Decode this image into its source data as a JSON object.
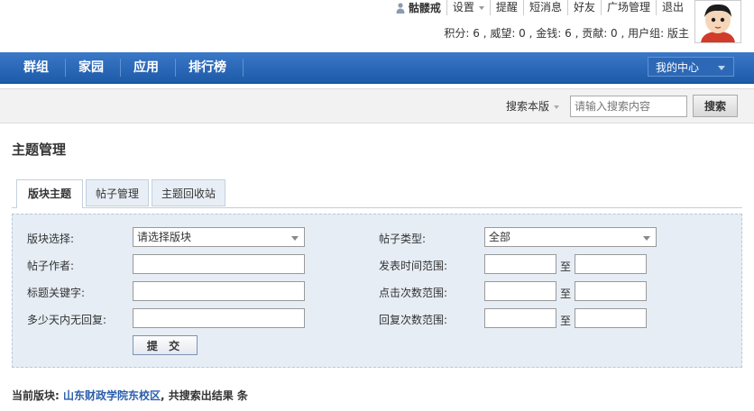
{
  "topbar": {
    "username": "骷髅戒",
    "links": [
      "设置",
      "提醒",
      "短消息",
      "好友",
      "广场管理",
      "退出"
    ],
    "stats": "积分: 6 , 威望: 0 , 金钱: 6 , 贡献: 0 , 用户组: 版主"
  },
  "nav": {
    "items": [
      "群组",
      "家园",
      "应用",
      "排行榜"
    ],
    "my_center": "我的中心"
  },
  "search": {
    "scope": "搜索本版",
    "placeholder": "请输入搜索内容",
    "button": "搜索"
  },
  "page_title": "主题管理",
  "tabs": [
    "版块主题",
    "帖子管理",
    "主题回收站"
  ],
  "form": {
    "forum_label": "版块选择:",
    "forum_value": "请选择版块",
    "author_label": "帖子作者:",
    "keyword_label": "标题关键字:",
    "noreply_label": "多少天内无回复:",
    "type_label": "帖子类型:",
    "type_value": "全部",
    "time_label": "发表时间范围:",
    "click_label": "点击次数范围:",
    "reply_label": "回复次数范围:",
    "to": "至",
    "submit": "提 交"
  },
  "result": {
    "prefix": "当前版块: ",
    "forum": "山东财政学院东校区",
    "suffix": ", 共搜索出结果 条"
  },
  "colors": {
    "nav_blue": "#2563b0",
    "panel_bg": "#e6edf5",
    "link_blue": "#2b5eab"
  }
}
